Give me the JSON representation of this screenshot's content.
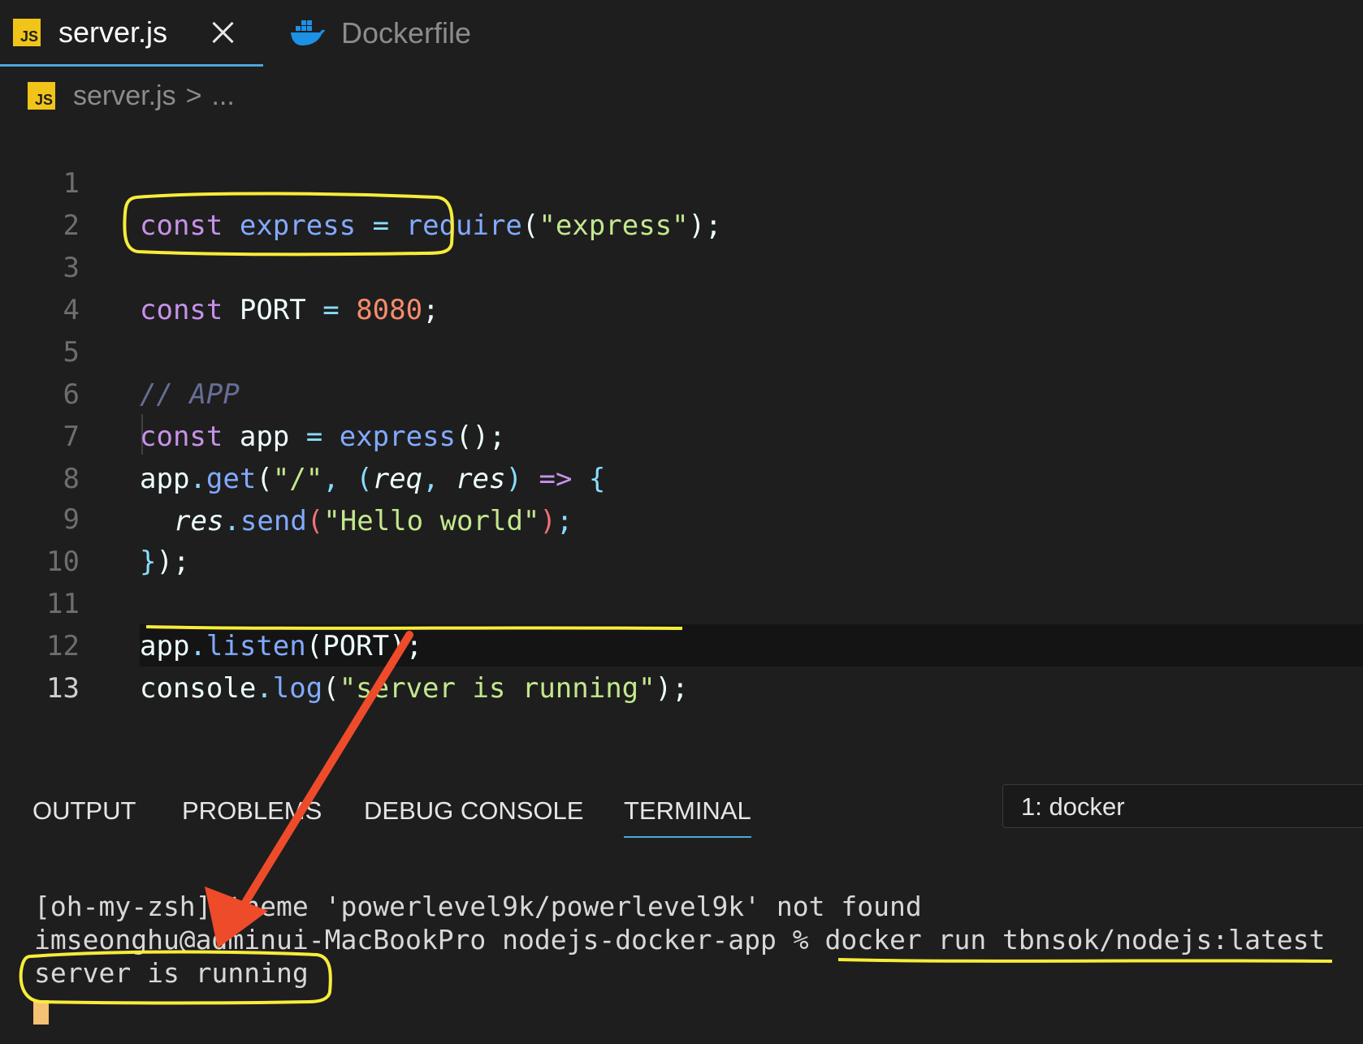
{
  "tabs": [
    {
      "label": "server.js",
      "icon": "js-file-icon",
      "active": true
    },
    {
      "label": "Dockerfile",
      "icon": "docker-whale-icon",
      "active": false
    }
  ],
  "breadcrumb": {
    "file": "server.js",
    "separator": ">",
    "more": "..."
  },
  "editor": {
    "line_numbers": [
      "1",
      "2",
      "3",
      "4",
      "5",
      "6",
      "7",
      "8",
      "9",
      "10",
      "11",
      "12",
      "13"
    ],
    "current_line": "13",
    "code": {
      "l1": {
        "kw": "const",
        "name": "express",
        "eq": "=",
        "fn": "require",
        "open": "(",
        "str": "\"express\"",
        "close": ");"
      },
      "l3": {
        "kw": "const",
        "name": "PORT",
        "eq": "=",
        "num": "8080",
        "semi": ";"
      },
      "l5": {
        "comment": "// APP"
      },
      "l6": {
        "kw": "const",
        "name": "app",
        "eq": "=",
        "fn": "express",
        "tail": "();"
      },
      "l7": {
        "obj": "app",
        "dot": ".",
        "fn": "get",
        "open": "(",
        "str": "\"/\"",
        "comma": ",",
        "popen": "(",
        "p1": "req",
        "pcomma": ",",
        "p2": "res",
        "pclose": ")",
        "arrow": "=>",
        "brace": "{"
      },
      "l8": {
        "obj": "res",
        "dot": ".",
        "fn": "send",
        "open": "(",
        "str": "\"Hello world\"",
        "close": ")",
        "semi": ";"
      },
      "l9": {
        "brace": "}",
        "tail": ");"
      },
      "l11": {
        "obj": "app",
        "dot": ".",
        "fn": "listen",
        "open": "(",
        "arg": "PORT",
        "close": ");"
      },
      "l12": {
        "obj": "console",
        "dot": ".",
        "fn": "log",
        "open": "(",
        "str": "\"server is running\"",
        "close": ");"
      }
    }
  },
  "panel": {
    "tabs": [
      "OUTPUT",
      "PROBLEMS",
      "DEBUG CONSOLE",
      "TERMINAL"
    ],
    "active_tab": "TERMINAL",
    "terminal_selector": "1: docker"
  },
  "terminal": {
    "line1": "[oh-my-zsh] theme 'powerlevel9k/powerlevel9k' not found",
    "line2": "imseonghu@adminui-MacBookPro nodejs-docker-app % docker run tbnsok/nodejs:latest",
    "line3": "server is running"
  },
  "colors": {
    "annotation_highlight": "#f7ec3a",
    "annotation_arrow": "#ee4b2b",
    "accent": "#4aa8d8"
  }
}
